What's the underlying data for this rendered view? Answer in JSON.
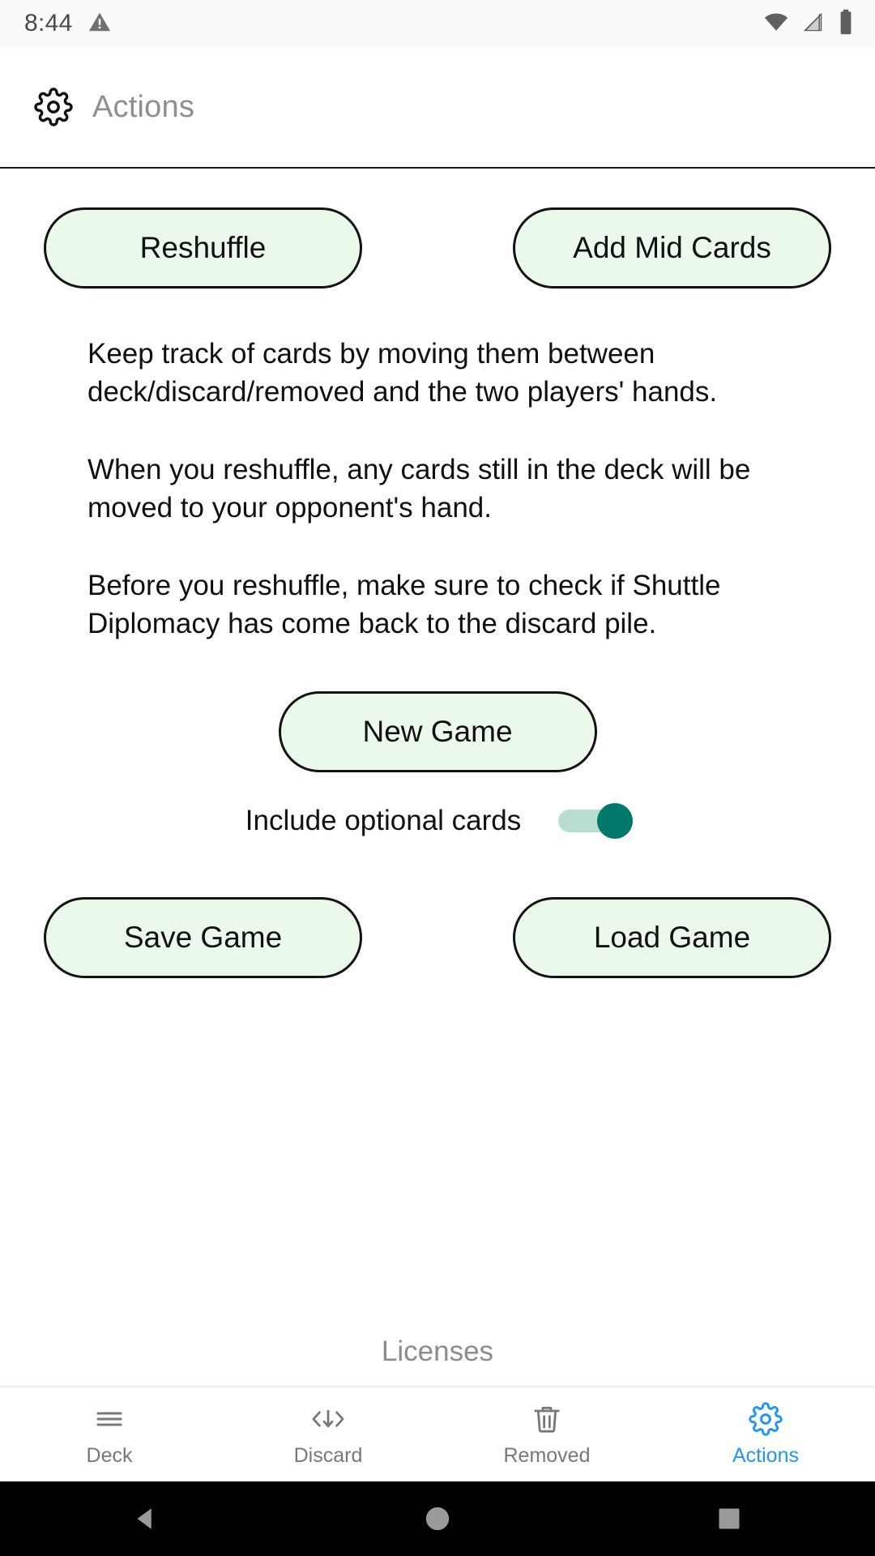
{
  "status_bar": {
    "time": "8:44",
    "warning_icon": "warning-triangle-icon",
    "wifi_icon": "wifi-icon",
    "signal_icon": "cell-signal-icon",
    "battery_icon": "battery-full-icon"
  },
  "app_bar": {
    "icon": "gear-icon",
    "title": "Actions",
    "title_color": "#8f8f8f"
  },
  "actions": {
    "reshuffle_label": "Reshuffle",
    "add_mid_cards_label": "Add Mid Cards",
    "new_game_label": "New Game",
    "save_game_label": "Save Game",
    "load_game_label": "Load Game",
    "button_fill": "#eaf9ea",
    "button_border": "#131313"
  },
  "info": {
    "paragraph_1": "Keep track of cards by moving them between deck/discard/removed and the two players' hands.",
    "paragraph_2": "When you reshuffle, any cards still in the deck will be moved to your opponent's hand.",
    "paragraph_3": "Before you reshuffle, make sure to check if Shuttle Diplomacy has come back to the discard pile."
  },
  "optional_cards_toggle": {
    "label": "Include optional cards",
    "state": "on",
    "knob_color": "#00796b",
    "track_color": "#b6ddce"
  },
  "footer": {
    "licenses_label": "Licenses"
  },
  "bottom_nav": {
    "active_color": "#2196f3",
    "inactive_color": "#787878",
    "items": [
      {
        "label": "Deck",
        "icon": "hamburger-menu-icon",
        "active": false
      },
      {
        "label": "Discard",
        "icon": "code-arrows-down-icon",
        "active": false
      },
      {
        "label": "Removed",
        "icon": "trash-icon",
        "active": false
      },
      {
        "label": "Actions",
        "icon": "gear-icon",
        "active": true
      }
    ]
  },
  "system_nav": {
    "back_label": "back-triangle-icon",
    "home_label": "home-circle-icon",
    "recents_label": "recents-square-icon"
  }
}
